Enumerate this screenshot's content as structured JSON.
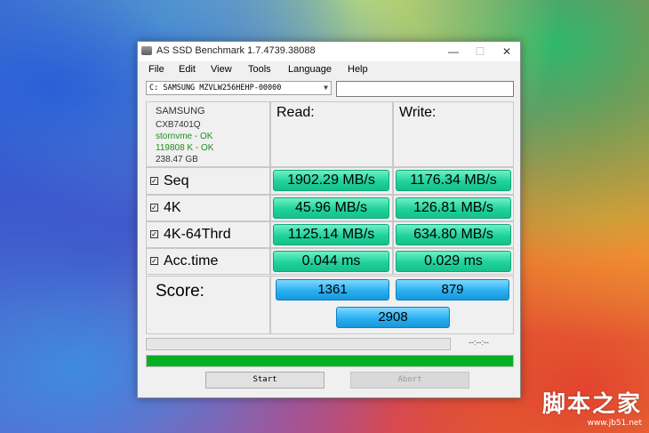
{
  "window": {
    "title": "AS SSD Benchmark 1.7.4739.38088",
    "minimize": "—",
    "maximize": "☐",
    "close": "✕"
  },
  "menu": [
    "File",
    "Edit",
    "View",
    "Tools",
    "Language",
    "Help"
  ],
  "drive": {
    "selected": "C: SAMSUNG MZVLW256HEHP-00000",
    "extra_value": ""
  },
  "info": {
    "vendor": "SAMSUNG",
    "firmware": "CXB7401Q",
    "driver": "stornvme - OK",
    "alignment": "119808 K - OK",
    "capacity": "238.47 GB"
  },
  "columns": {
    "read": "Read:",
    "write": "Write:"
  },
  "rows": [
    {
      "label": "Seq",
      "read": "1902.29 MB/s",
      "write": "1176.34 MB/s"
    },
    {
      "label": "4K",
      "read": "45.96 MB/s",
      "write": "126.81 MB/s"
    },
    {
      "label": "4K-64Thrd",
      "read": "1125.14 MB/s",
      "write": "634.80 MB/s"
    },
    {
      "label": "Acc.time",
      "read": "0.044 ms",
      "write": "0.029 ms"
    }
  ],
  "score": {
    "label": "Score:",
    "read": "1361",
    "write": "879",
    "total": "2908"
  },
  "status": {
    "timer": "--:--:--",
    "progress_top": 0,
    "progress_bottom": 1.0
  },
  "buttons": {
    "start": "Start",
    "abort": "Abort"
  },
  "colors": {
    "value_bar": "#1fd29a",
    "score_bar": "#2aaff0",
    "progress": "#06b025",
    "info_green": "#1f8f1f"
  },
  "watermark": {
    "main": "脚本之家",
    "sub": "www.jb51.net"
  }
}
